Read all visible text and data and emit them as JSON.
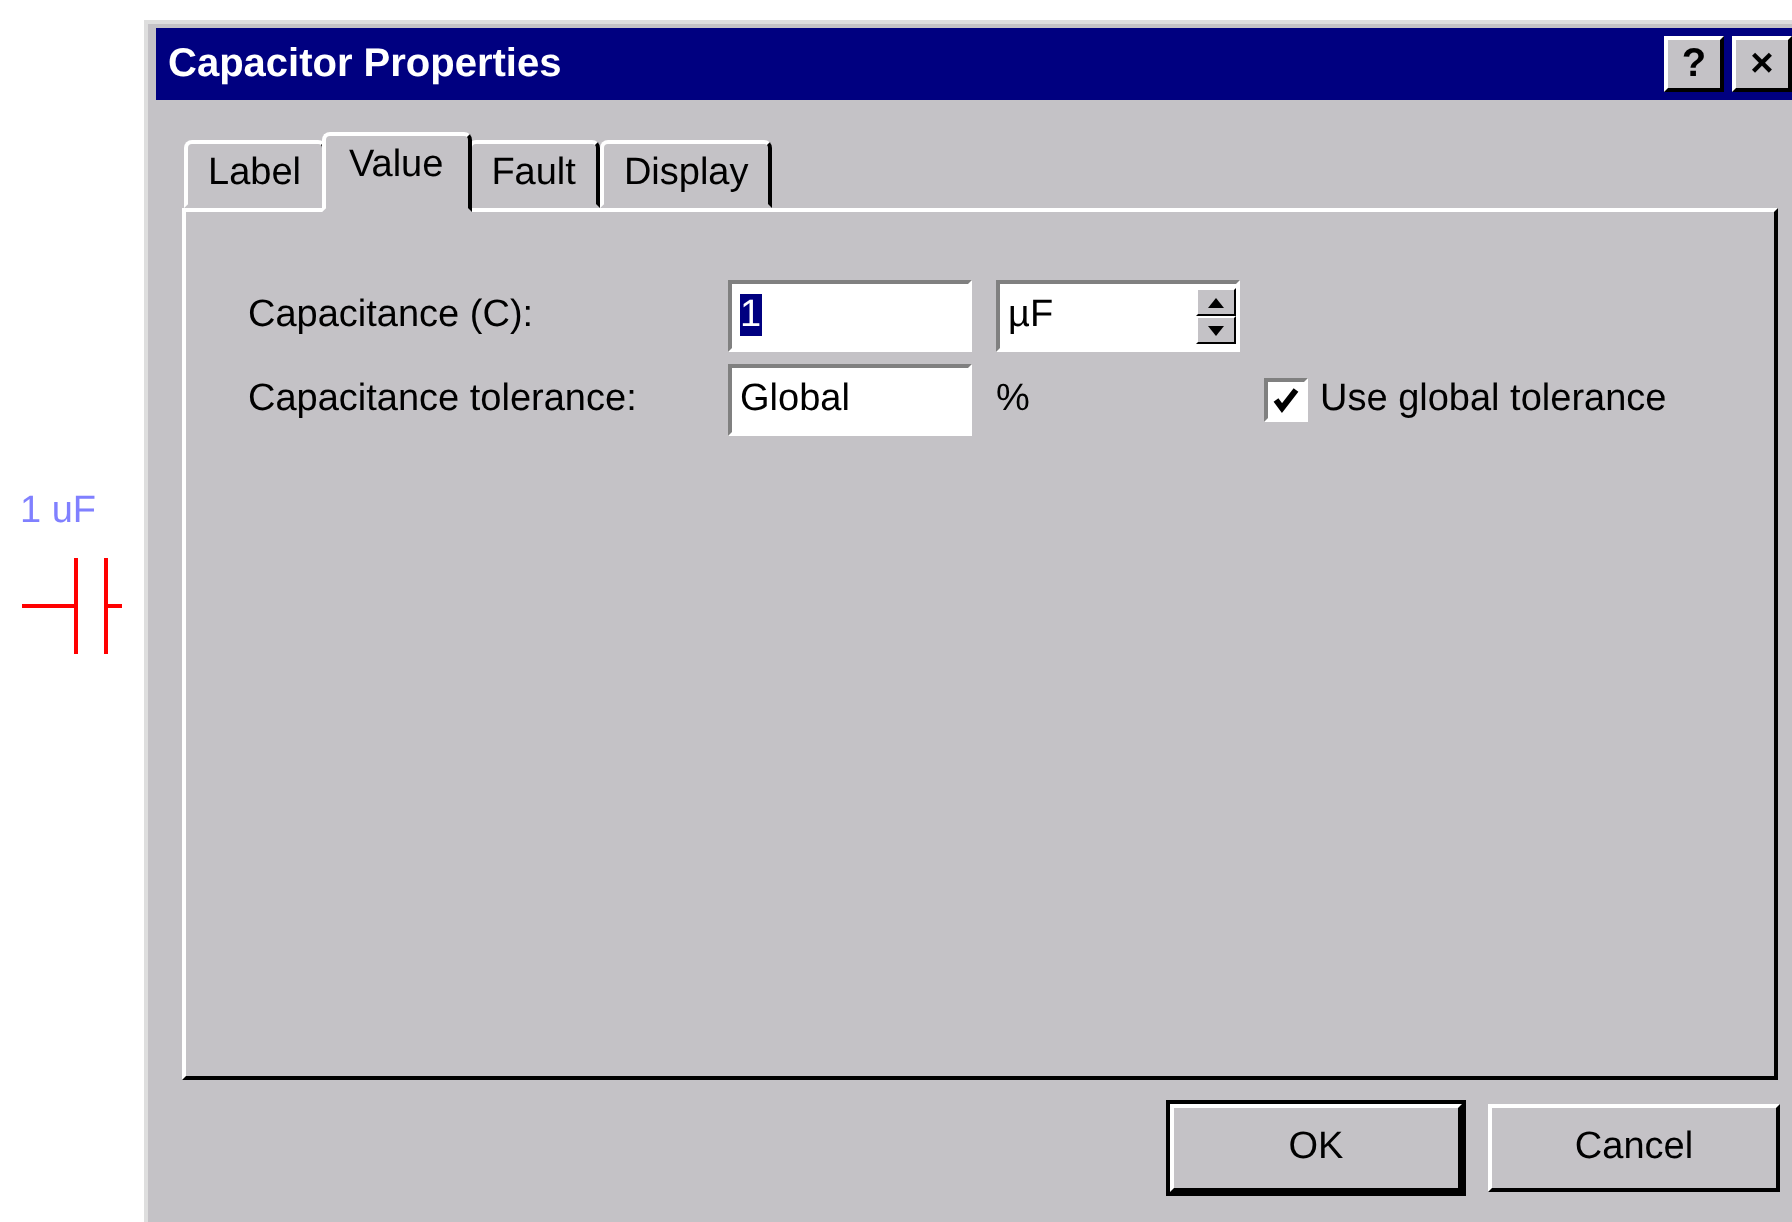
{
  "schematic": {
    "label": "1 uF"
  },
  "dialog": {
    "title": "Capacitor Properties",
    "help_button": "?",
    "close_button": "×",
    "tabs": [
      {
        "label": "Label",
        "selected": false
      },
      {
        "label": "Value",
        "selected": true
      },
      {
        "label": "Fault",
        "selected": false
      },
      {
        "label": "Display",
        "selected": false
      }
    ],
    "rows": [
      {
        "label": "Capacitance (C):",
        "value": "1",
        "value_selected": true,
        "unit": {
          "kind": "spinner",
          "value": "µF"
        }
      },
      {
        "label": "Capacitance tolerance:",
        "value": "Global",
        "value_selected": false,
        "unit": {
          "kind": "text",
          "value": "%"
        },
        "checkbox": {
          "label": "Use global tolerance",
          "checked": true
        }
      }
    ],
    "buttons": [
      {
        "label": "OK",
        "default": true
      },
      {
        "label": "Cancel",
        "default": false
      }
    ]
  }
}
